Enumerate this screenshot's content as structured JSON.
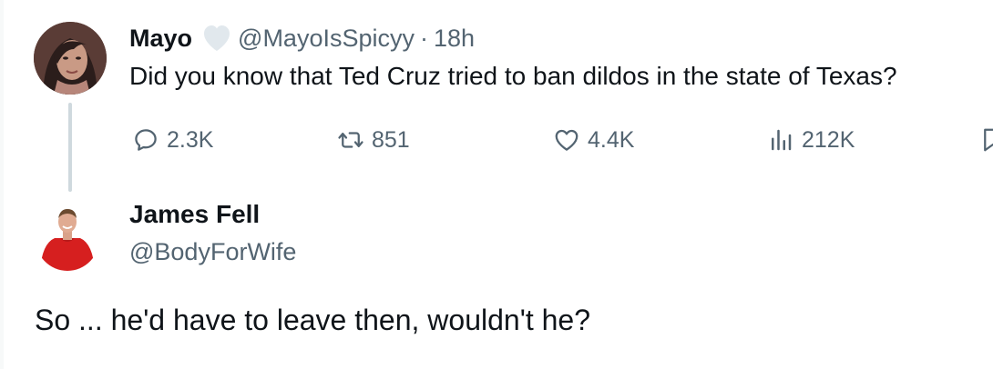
{
  "parent": {
    "display_name": "Mayo",
    "handle": "@MayoIsSpicyy",
    "separator": "·",
    "time": "18h",
    "text": "Did you know that Ted Cruz tried to ban dildos in the state of Texas?",
    "stats": {
      "replies": "2.3K",
      "retweets": "851",
      "likes": "4.4K",
      "views": "212K"
    },
    "icons": [
      "reply-icon",
      "retweet-icon",
      "like-icon",
      "views-icon",
      "bookmark-icon",
      "verified-heart-icon"
    ]
  },
  "reply": {
    "display_name": "James Fell",
    "handle": "@BodyForWife",
    "text": "So ... he'd have to leave then, wouldn't he?"
  },
  "colors": {
    "text_primary": "#0f1419",
    "text_secondary": "#536471",
    "thread_line": "#cfd9de",
    "verify_heart": "#e1e8ed"
  }
}
